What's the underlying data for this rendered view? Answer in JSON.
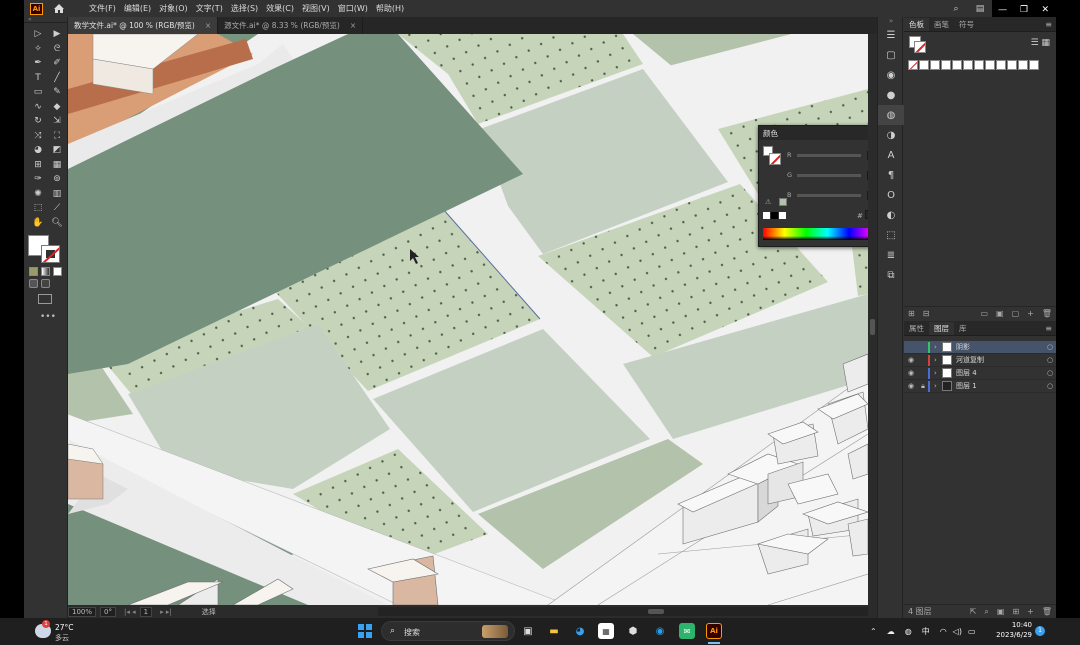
{
  "app": {
    "logo": "Ai"
  },
  "menu": [
    "文件(F)",
    "编辑(E)",
    "对象(O)",
    "文字(T)",
    "选择(S)",
    "效果(C)",
    "视图(V)",
    "窗口(W)",
    "帮助(H)"
  ],
  "tabs": [
    {
      "label": "教学文件.ai* @ 100 % (RGB/预览)",
      "close": "×"
    },
    {
      "label": "源文件.ai* @ 8.33 % (RGB/预览)",
      "close": "×"
    }
  ],
  "status": {
    "zoom": "100%",
    "angle": "0°",
    "artboard": "1",
    "mode": "选择"
  },
  "right_panel": {
    "tabs": [
      "色板",
      "画笔",
      "符号"
    ],
    "layer_tabs": [
      "属性",
      "图层",
      "库"
    ],
    "layers": [
      {
        "name": "阴影",
        "color": "#35c46a",
        "selected": true
      },
      {
        "name": "河道复制",
        "color": "#d0423c",
        "selected": false
      },
      {
        "name": "图层 4",
        "color": "#4a6cd6",
        "selected": false
      },
      {
        "name": "图层 1",
        "color": "#4a6cd6",
        "selected": false
      }
    ],
    "layers_footer": "4 图层"
  },
  "color_panel": {
    "title": "颜色",
    "labels": [
      "R",
      "G",
      "B"
    ],
    "hex_label": "#"
  },
  "colors": {
    "dark_green": "#75907d",
    "field_light": "#c4d1c2",
    "field_dotted": "#c6d5ba",
    "road": "#f1f1f1",
    "field_mid": "#b3c2aa",
    "accent_orange": "#ff9a00"
  },
  "taskbar": {
    "temp": "27°C",
    "weather": "多云",
    "search": "搜索",
    "ime": "中",
    "time": "10:40",
    "date": "2023/6/29",
    "notify": "1",
    "weather_badge": "1"
  }
}
